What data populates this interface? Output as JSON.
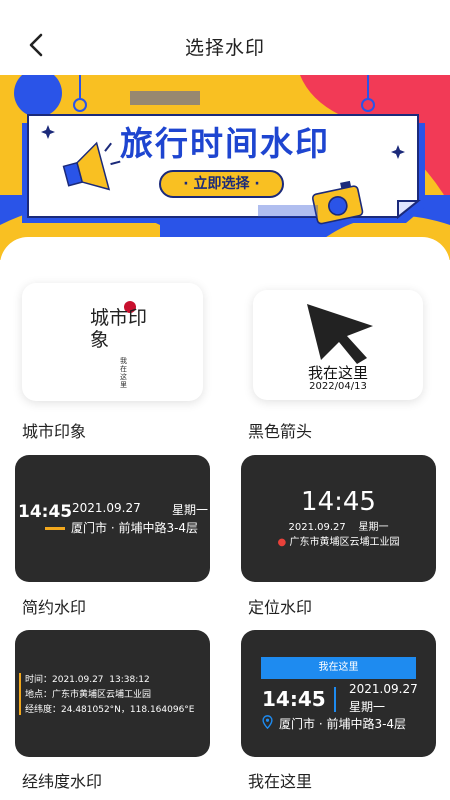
{
  "header": {
    "title": "选择水印"
  },
  "banner": {
    "title": "旅行时间水印",
    "button_label": "· 立即选择 ·"
  },
  "cards": [
    {
      "label": "城市印象",
      "art_text": "城市印象",
      "sub_text": "我在这里"
    },
    {
      "label": "黑色箭头",
      "place": "我在这里",
      "date": "2022/04/13"
    },
    {
      "label": "简约水印",
      "time": "14:45",
      "date": "2021.09.27",
      "weekday": "星期一",
      "location": "厦门市 · 前埔中路3-4层"
    },
    {
      "label": "定位水印",
      "time": "14:45",
      "date_line": "2021.09.27    星期一",
      "location": "广东市黄埔区云埔工业园"
    },
    {
      "label": "经纬度水印",
      "time_line": "时间：2021.09.27  13:38:12",
      "place_line": "地点：广东市黄埔区云埔工业园",
      "coord_line": "经纬度：24.481052°N，118.164096°E"
    },
    {
      "label": "我在这里",
      "top_bar": "我在这里",
      "time": "14:45",
      "date": "2021.09.27",
      "weekday": "星期一",
      "location": "厦门市 · 前埔中路3-4层"
    }
  ],
  "colors": {
    "banner_yellow": "#f9c022",
    "banner_blue": "#2a54e8",
    "banner_red": "#f23a56",
    "card_dark": "#2b2b2b",
    "accent_orange": "#f2a81d",
    "accent_blue": "#1e8bf0"
  }
}
